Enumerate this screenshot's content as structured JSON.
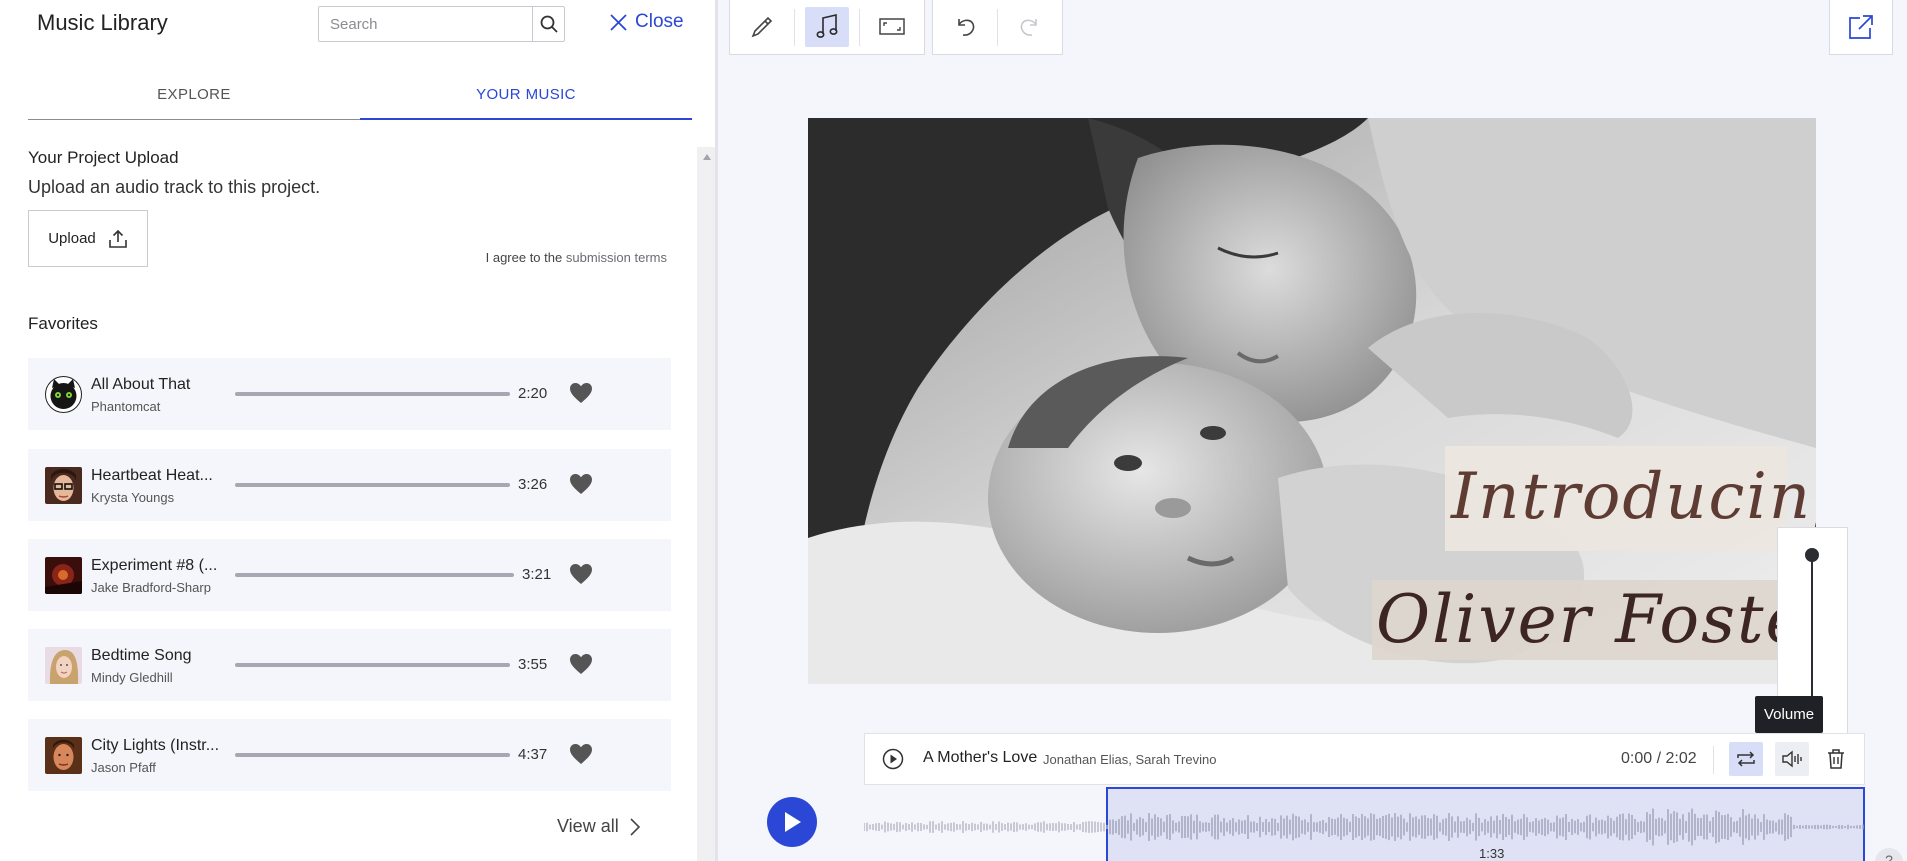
{
  "library": {
    "title": "Music Library",
    "search_placeholder": "Search",
    "close_label": "Close",
    "tabs": [
      {
        "label": "EXPLORE",
        "active": false
      },
      {
        "label": "YOUR MUSIC",
        "active": true
      }
    ],
    "upload": {
      "heading": "Your Project Upload",
      "description": "Upload an audio track to this project.",
      "button_label": "Upload",
      "terms_prefix": "I agree to the",
      "terms_link": "submission terms"
    },
    "favorites": {
      "heading": "Favorites",
      "tracks": [
        {
          "title": "All About That",
          "artist": "Phantomcat",
          "duration": "2:20",
          "thumb": "cat-avatar",
          "favorited": true
        },
        {
          "title": "Heartbeat Heat...",
          "artist": "Krysta Youngs",
          "duration": "3:26",
          "thumb": "woman-glasses-avatar",
          "favorited": true
        },
        {
          "title": "Experiment #8 (...",
          "artist": "Jake Bradford-Sharp",
          "duration": "3:21",
          "thumb": "album-art",
          "favorited": true
        },
        {
          "title": "Bedtime Song",
          "artist": "Mindy Gledhill",
          "duration": "3:55",
          "thumb": "woman-avatar",
          "favorited": true
        },
        {
          "title": "City Lights (Instr...",
          "artist": "Jason Pfaff",
          "duration": "4:37",
          "thumb": "man-avatar",
          "favorited": true
        }
      ],
      "view_all_label": "View all"
    }
  },
  "toolbar": {
    "tools": [
      "brush-icon",
      "music-note-icon",
      "aspect-ratio-icon"
    ],
    "active_tool": "music-note-icon",
    "history": [
      "undo-icon",
      "redo-icon"
    ],
    "share": "share-external-icon"
  },
  "canvas": {
    "title_lines": [
      "Introducing",
      "Oliver Foster"
    ],
    "image": "mother-kissing-baby-photo"
  },
  "volume": {
    "tooltip": "Volume",
    "level": 1.0
  },
  "audio": {
    "title": "A Mother's Love",
    "artist": "Jonathan Elias, Sarah Trevino",
    "time": "0:00 / 2:02",
    "marker": "1:33"
  },
  "help_label": "?",
  "colors": {
    "accent": "#2a47d6",
    "accent_light": "#d9def8",
    "panel_bg": "#f5f6fb"
  }
}
